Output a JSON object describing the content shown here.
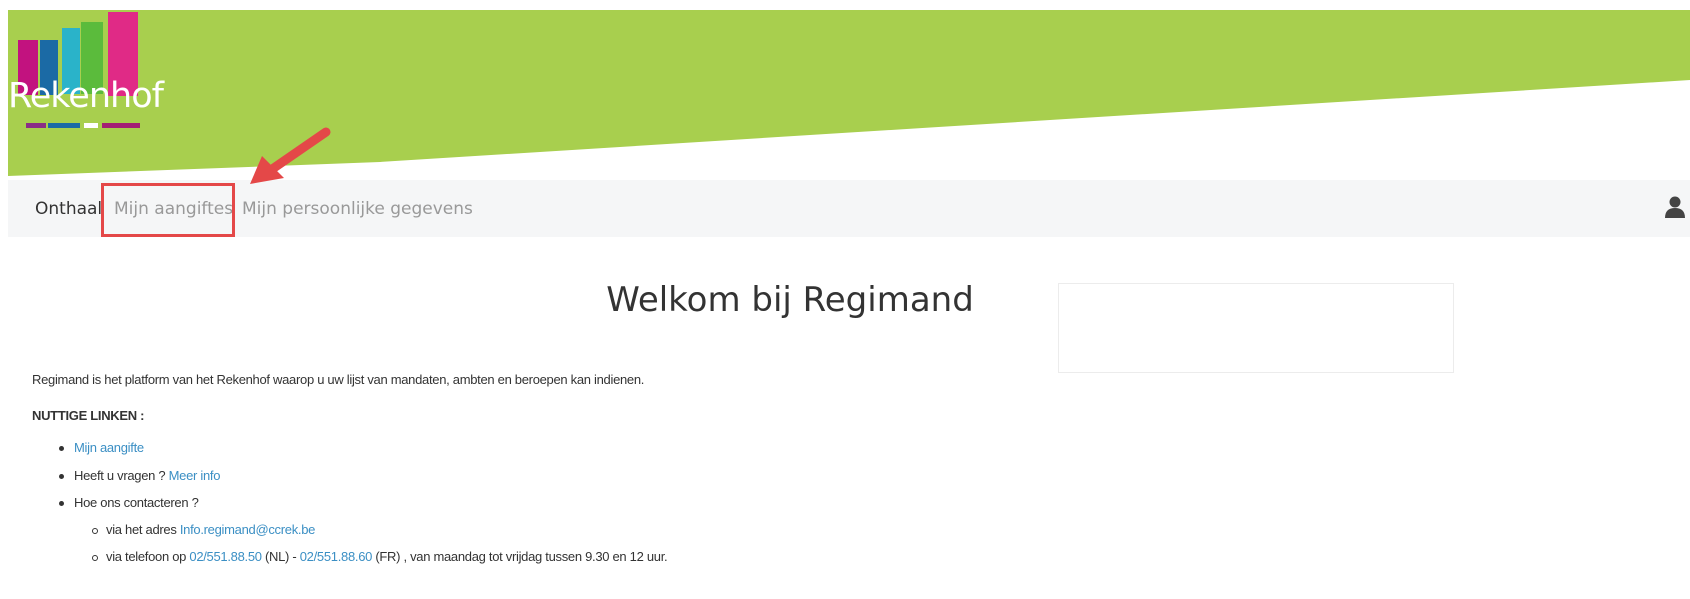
{
  "header": {
    "logo_text": "Rekenhof",
    "brand_color": "#a8cf4e"
  },
  "nav": {
    "items": [
      {
        "label": "Onthaal"
      },
      {
        "label": "Mijn aangiftes"
      },
      {
        "label": "Mijn persoonlijke gegevens"
      }
    ],
    "user_icon": "user-icon"
  },
  "annotation": {
    "color": "#e44848",
    "icon": "arrow-icon"
  },
  "main": {
    "title": "Welkom bij Regimand",
    "intro": "Regimand is het platform van het Rekenhof waarop u uw lijst van mandaten, ambten en beroepen kan indienen.",
    "links_heading": "NUTTIGE LINKEN :",
    "links": {
      "aangifte": "Mijn aangifte",
      "vragen_text": "Heeft u vragen ? ",
      "meer_info": "Meer info",
      "contact_text": "Hoe ons contacteren ?",
      "adres_text": "via het adres ",
      "email": "Info.regimand@ccrek.be",
      "tel_text": "via telefoon op ",
      "tel_nl": "02/551.88.50",
      "nl_label": " (NL) - ",
      "tel_fr": "02/551.88.60",
      "fr_label": " (FR) , van maandag tot vrijdag tussen 9.30 en 12 uur."
    }
  }
}
